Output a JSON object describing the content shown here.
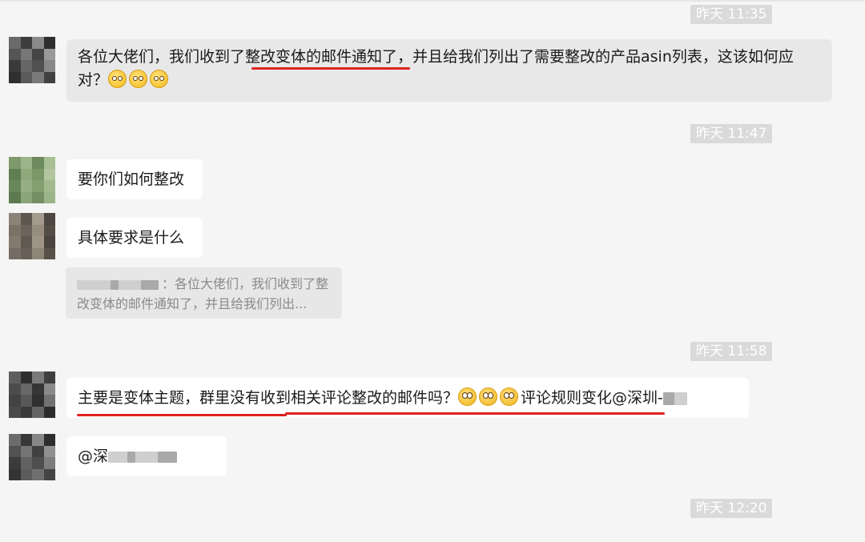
{
  "timestamps": [
    "昨天 11:35",
    "昨天 11:47",
    "昨天 11:58",
    "昨天 12:20"
  ],
  "messages": [
    {
      "text": "各位大佬们，我们收到了整改变体的邮件通知了，并且给我们列出了需要整改的产品asin列表，这该如何应对？"
    },
    {
      "text": "要你们如何整改"
    },
    {
      "text": "具体要求是什么"
    },
    {
      "text": "主要是变体主题，群里没有收到相关评论整改的邮件吗？",
      "text_after": "评论规则变化@深圳-"
    },
    {
      "text": "@深"
    }
  ],
  "quote": {
    "text": "：各位大佬们，我们收到了整改变体的邮件通知了，并且给我们列出..."
  },
  "emoji_names": [
    "pleading-face-emoji",
    "flushed-face-emoji"
  ],
  "colors": {
    "background": "#f5f5f5",
    "bubble": "#ffffff",
    "own_bubble": "#e8e8e8",
    "timestamp": "#dadada",
    "underline": "#e02020"
  }
}
